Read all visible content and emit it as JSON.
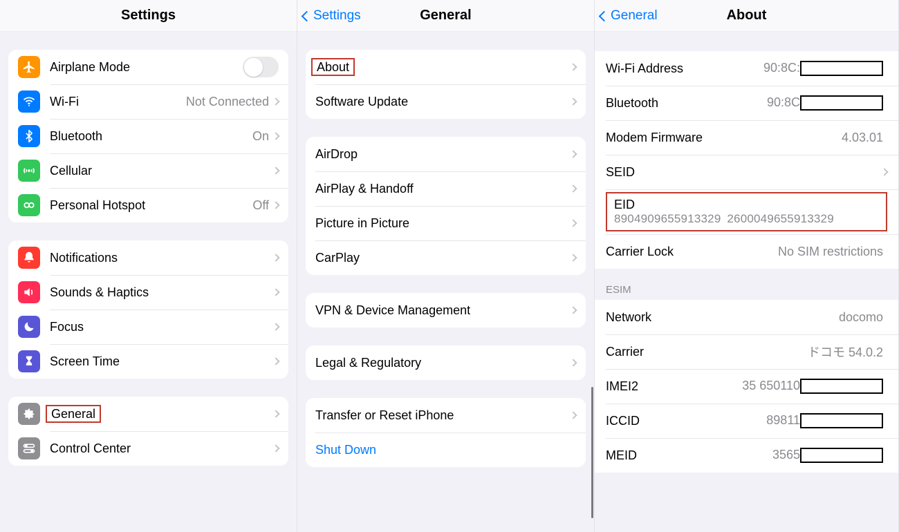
{
  "pane1": {
    "title": "Settings",
    "g1": [
      {
        "icon": "airplane",
        "color": "#ff9500",
        "label": "Airplane Mode",
        "type": "toggle"
      },
      {
        "icon": "wifi",
        "color": "#007aff",
        "label": "Wi-Fi",
        "value": "Not Connected"
      },
      {
        "icon": "bluetooth",
        "color": "#007aff",
        "label": "Bluetooth",
        "value": "On"
      },
      {
        "icon": "cellular",
        "color": "#34c759",
        "label": "Cellular"
      },
      {
        "icon": "hotspot",
        "color": "#34c759",
        "label": "Personal Hotspot",
        "value": "Off"
      }
    ],
    "g2": [
      {
        "icon": "bell",
        "color": "#ff3b30",
        "label": "Notifications"
      },
      {
        "icon": "speaker",
        "color": "#ff2d55",
        "label": "Sounds & Haptics"
      },
      {
        "icon": "moon",
        "color": "#5856d6",
        "label": "Focus"
      },
      {
        "icon": "hourglass",
        "color": "#5856d6",
        "label": "Screen Time"
      }
    ],
    "g3": [
      {
        "icon": "gear",
        "color": "#8e8e93",
        "label": "General",
        "hl": true
      },
      {
        "icon": "switches",
        "color": "#8e8e93",
        "label": "Control Center"
      }
    ]
  },
  "pane2": {
    "back": "Settings",
    "title": "General",
    "g1": [
      {
        "label": "About",
        "hl": true
      },
      {
        "label": "Software Update"
      }
    ],
    "g2": [
      {
        "label": "AirDrop"
      },
      {
        "label": "AirPlay & Handoff"
      },
      {
        "label": "Picture in Picture"
      },
      {
        "label": "CarPlay"
      }
    ],
    "g3": [
      {
        "label": "VPN & Device Management"
      }
    ],
    "g4": [
      {
        "label": "Legal & Regulatory"
      }
    ],
    "g5": [
      {
        "label": "Transfer or Reset iPhone"
      },
      {
        "label": "Shut Down",
        "blue": true,
        "nochevron": true
      }
    ]
  },
  "pane3": {
    "back": "General",
    "title": "About",
    "rows1": [
      {
        "label": "Wi-Fi Address",
        "value": "90:8C:",
        "redact": true
      },
      {
        "label": "Bluetooth",
        "value": "90:8C",
        "redact": true
      },
      {
        "label": "Modem Firmware",
        "value": "4.03.01"
      },
      {
        "label": "SEID",
        "chevron": true
      }
    ],
    "eid": {
      "label": "EID",
      "value": "8904909655913329 2600049655913329"
    },
    "rows2": [
      {
        "label": "Carrier Lock",
        "value": "No SIM restrictions"
      }
    ],
    "esim_header": "ESIM",
    "esim": [
      {
        "label": "Network",
        "value": "docomo"
      },
      {
        "label": "Carrier",
        "value": "ドコモ 54.0.2"
      },
      {
        "label": "IMEI2",
        "value": "35 650110",
        "redact": true
      },
      {
        "label": "ICCID",
        "value": "89811",
        "redact": true
      },
      {
        "label": "MEID",
        "value": "3565",
        "redact": true
      }
    ]
  }
}
